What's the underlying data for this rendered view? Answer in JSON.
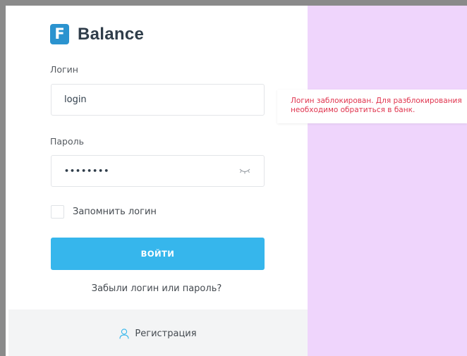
{
  "logo": {
    "badge_letter": "F",
    "name": "Balance"
  },
  "login_field": {
    "label": "Логин",
    "value": "login"
  },
  "password_field": {
    "label": "Пароль",
    "value": "••••••••"
  },
  "remember": {
    "label": "Запомнить логин"
  },
  "login_button": {
    "label": "ВОЙТИ"
  },
  "forgot": {
    "label": "Забыли логин или пароль?"
  },
  "register": {
    "label": "Регистрация"
  },
  "error": {
    "message": "Логин заблокирован. Для разблокирования необходимо обратиться в банк."
  },
  "icons": {
    "eye": "eye-closed-icon",
    "user": "user-icon"
  },
  "colors": {
    "accent": "#36b6ec",
    "brand": "#2b93cf",
    "error": "#e0344e",
    "side_background": "#efd5fc"
  }
}
